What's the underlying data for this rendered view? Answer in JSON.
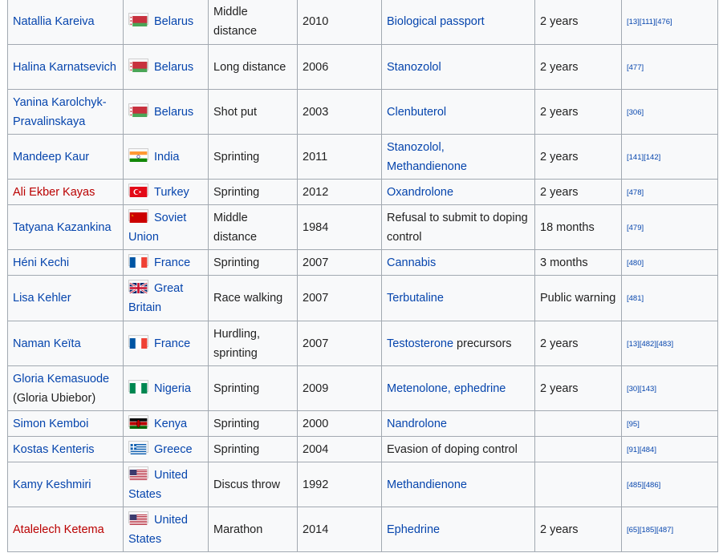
{
  "rows": [
    {
      "name": "Natallia Kareiva",
      "name_red": false,
      "name_note": "",
      "country": "Belarus",
      "flag": "belarus",
      "event": "Middle distance",
      "year": "2010",
      "substance": [
        {
          "t": "Biological passport",
          "link": true
        }
      ],
      "sanction": "2 years",
      "refs": "[13][111][476]"
    },
    {
      "name": "Halina Karnatsevich",
      "name_red": false,
      "name_note": "",
      "country": "Belarus",
      "flag": "belarus",
      "event": "Long distance",
      "year": "2006",
      "substance": [
        {
          "t": "Stanozolol",
          "link": true
        }
      ],
      "sanction": "2 years",
      "refs": "[477]"
    },
    {
      "name": "Yanina Karolchyk-Pravalinskaya",
      "name_red": false,
      "name_note": "",
      "country": "Belarus",
      "flag": "belarus",
      "event": "Shot put",
      "year": "2003",
      "substance": [
        {
          "t": "Clenbuterol",
          "link": true
        }
      ],
      "sanction": "2 years",
      "refs": "[306]"
    },
    {
      "name": "Mandeep Kaur",
      "name_red": false,
      "name_note": "",
      "country": "India",
      "flag": "india",
      "event": "Sprinting",
      "year": "2011",
      "substance": [
        {
          "t": "Stanozolol",
          "link": true
        },
        {
          "t": ", ",
          "link": true
        },
        {
          "t": "Methandienone",
          "link": true
        }
      ],
      "sanction": "2 years",
      "refs": "[141][142]"
    },
    {
      "name": "Ali Ekber Kayas",
      "name_red": true,
      "name_note": "",
      "country": "Turkey",
      "flag": "turkey",
      "event": "Sprinting",
      "year": "2012",
      "substance": [
        {
          "t": "Oxandrolone",
          "link": true
        }
      ],
      "sanction": "2 years",
      "refs": "[478]"
    },
    {
      "name": "Tatyana Kazankina",
      "name_red": false,
      "name_note": "",
      "country": "Soviet Union",
      "flag": "soviet",
      "event": "Middle distance",
      "year": "1984",
      "substance": [
        {
          "t": "Refusal to submit to doping control",
          "link": false
        }
      ],
      "sanction": "18 months",
      "refs": "[479]"
    },
    {
      "name": "Héni Kechi",
      "name_red": false,
      "name_note": "",
      "country": "France",
      "flag": "france",
      "event": "Sprinting",
      "year": "2007",
      "substance": [
        {
          "t": "Cannabis",
          "link": true
        }
      ],
      "sanction": "3 months",
      "refs": "[480]"
    },
    {
      "name": "Lisa Kehler",
      "name_red": false,
      "name_note": "",
      "country": "Great Britain",
      "flag": "uk",
      "event": "Race walking",
      "year": "2007",
      "substance": [
        {
          "t": "Terbutaline",
          "link": true
        }
      ],
      "sanction": "Public warning",
      "refs": "[481]"
    },
    {
      "name": "Naman Keïta",
      "name_red": false,
      "name_note": "",
      "country": "France",
      "flag": "france",
      "event": "Hurdling, sprinting",
      "year": "2007",
      "substance": [
        {
          "t": "Testosterone",
          "link": true
        },
        {
          "t": " precursors",
          "link": false
        }
      ],
      "sanction": "2 years",
      "refs": "[13][482][483]"
    },
    {
      "name": "Gloria Kemasuode",
      "name_red": false,
      "name_note": "(Gloria Ubiebor)",
      "country": "Nigeria",
      "flag": "nigeria",
      "event": "Sprinting",
      "year": "2009",
      "substance": [
        {
          "t": "Metenolone, ephedrine",
          "link": true
        }
      ],
      "sanction": "2 years",
      "refs": "[30][143]"
    },
    {
      "name": "Simon Kemboi",
      "name_red": false,
      "name_note": "",
      "country": "Kenya",
      "flag": "kenya",
      "event": "Sprinting",
      "year": "2000",
      "substance": [
        {
          "t": "Nandrolone",
          "link": true
        }
      ],
      "sanction": "",
      "refs": "[95]"
    },
    {
      "name": "Kostas Kenteris",
      "name_red": false,
      "name_note": "",
      "country": "Greece",
      "flag": "greece",
      "event": "Sprinting",
      "year": "2004",
      "substance": [
        {
          "t": "Evasion of doping control",
          "link": false
        }
      ],
      "sanction": "",
      "refs": "[91][484]"
    },
    {
      "name": "Kamy Keshmiri",
      "name_red": false,
      "name_note": "",
      "country": "United States",
      "flag": "usa",
      "event": "Discus throw",
      "year": "1992",
      "substance": [
        {
          "t": "Methandienone",
          "link": true
        }
      ],
      "sanction": "",
      "refs": "[485][486]"
    },
    {
      "name": "Atalelech Ketema",
      "name_red": true,
      "name_note": "",
      "country": "United States",
      "flag": "usa",
      "event": "Marathon",
      "year": "2014",
      "substance": [
        {
          "t": "Ephedrine",
          "link": true
        }
      ],
      "sanction": "2 years",
      "refs": "[65][185][487]"
    }
  ]
}
